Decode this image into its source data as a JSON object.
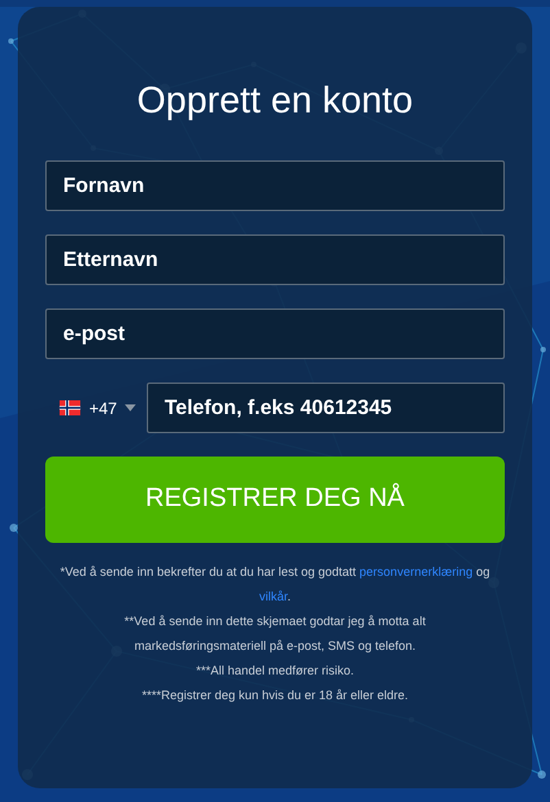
{
  "title": "Opprett en konto",
  "fields": [
    {
      "placeholder": "Fornavn"
    },
    {
      "placeholder": "Etternavn"
    },
    {
      "placeholder": "e-post"
    }
  ],
  "phone": {
    "country_code": "+47",
    "placeholder": "Telefon, f.eks 40612345"
  },
  "submit": "REGISTRER DEG NÅ",
  "consent": {
    "prefix": "*Ved å sende inn bekrefter du at du har lest og godtatt",
    "privacy_link": "personvernerklæring",
    "joiner": "og",
    "terms_link": "vilkår",
    "suffix": "."
  },
  "disclaimers": [
    "**Ved å sende inn dette skjemaet godtar jeg å motta alt markedsføringsmateriell på e-post, SMS og telefon.",
    "***All handel medfører risiko.",
    "****Registrer deg kun hvis du er 18 år eller eldre."
  ]
}
